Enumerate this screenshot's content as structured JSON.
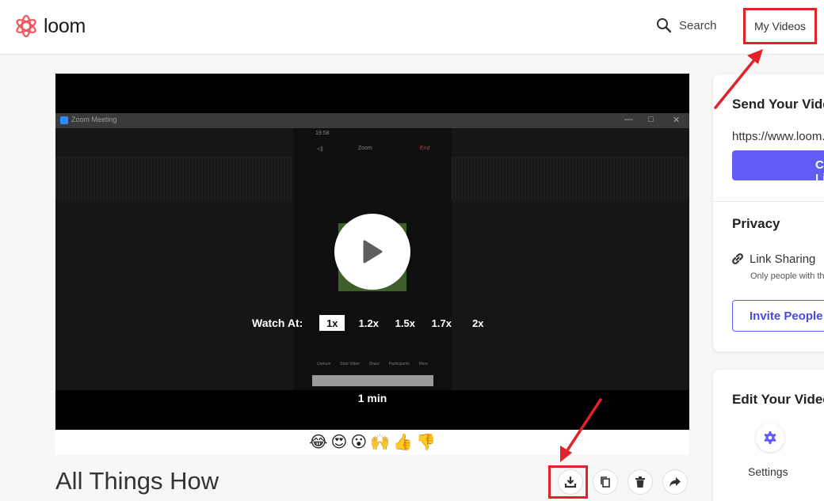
{
  "header": {
    "logo_text": "loom",
    "search_label": "Search",
    "my_videos_label": "My Videos"
  },
  "player": {
    "zoom_window_title": "Zoom Meeting",
    "phone_time": "19:58",
    "phone_menu": "Zoom",
    "phone_end": "End",
    "dock_items": [
      "Unmute",
      "Start Video",
      "Share",
      "Participants",
      "More"
    ],
    "watch_at_label": "Watch At:",
    "speeds": [
      "1x",
      "1.2x",
      "1.5x",
      "1.7x",
      "2x"
    ],
    "active_speed": "1x",
    "duration": "1 min"
  },
  "reactions": [
    "😂",
    "😍",
    "😮",
    "🙌",
    "👍",
    "👎"
  ],
  "video_title": "All Things How",
  "share_panel": {
    "send_title": "Send Your Video",
    "url": "https://www.loom.com/share",
    "copy_label": "Copy Link",
    "privacy_title": "Privacy",
    "link_sharing_label": "Link Sharing",
    "only_people_text": "Only people with the link",
    "invite_label": "Invite People"
  },
  "edit_panel": {
    "title": "Edit Your Video",
    "settings_label": "Settings"
  },
  "colors": {
    "accent": "#615cf5",
    "highlight": "#e0222a",
    "logo": "#f0545c"
  }
}
